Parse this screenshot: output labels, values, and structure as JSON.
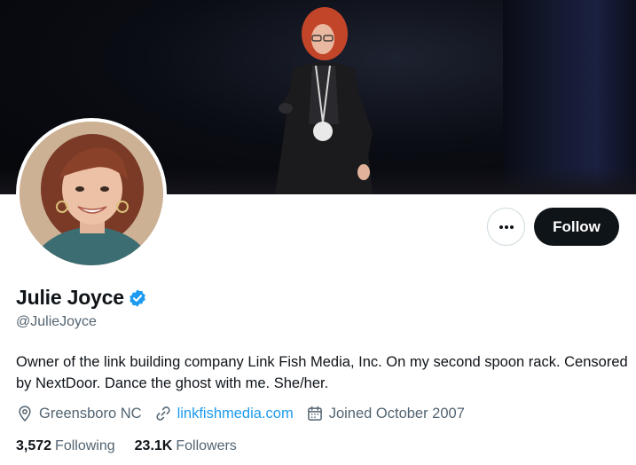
{
  "profile": {
    "name": "Julie Joyce",
    "handle": "@JulieJoyce",
    "verified": true,
    "bio": "Owner of the link building company Link Fish Media, Inc. On my second spoon rack. Censored by NextDoor. Dance the ghost with me. She/her.",
    "location": "Greensboro NC",
    "website": "linkfishmedia.com",
    "joined": "Joined October 2007"
  },
  "actions": {
    "more_icon": "more-horizontal-icon",
    "follow_label": "Follow"
  },
  "stats": {
    "following_count": "3,572",
    "following_label": "Following",
    "followers_count": "23.1K",
    "followers_label": "Followers"
  },
  "colors": {
    "accent": "#1d9bf0",
    "text_primary": "#0f1419",
    "text_secondary": "#536471",
    "button_dark": "#0f1419",
    "verified_badge": "#1d9bf0"
  }
}
